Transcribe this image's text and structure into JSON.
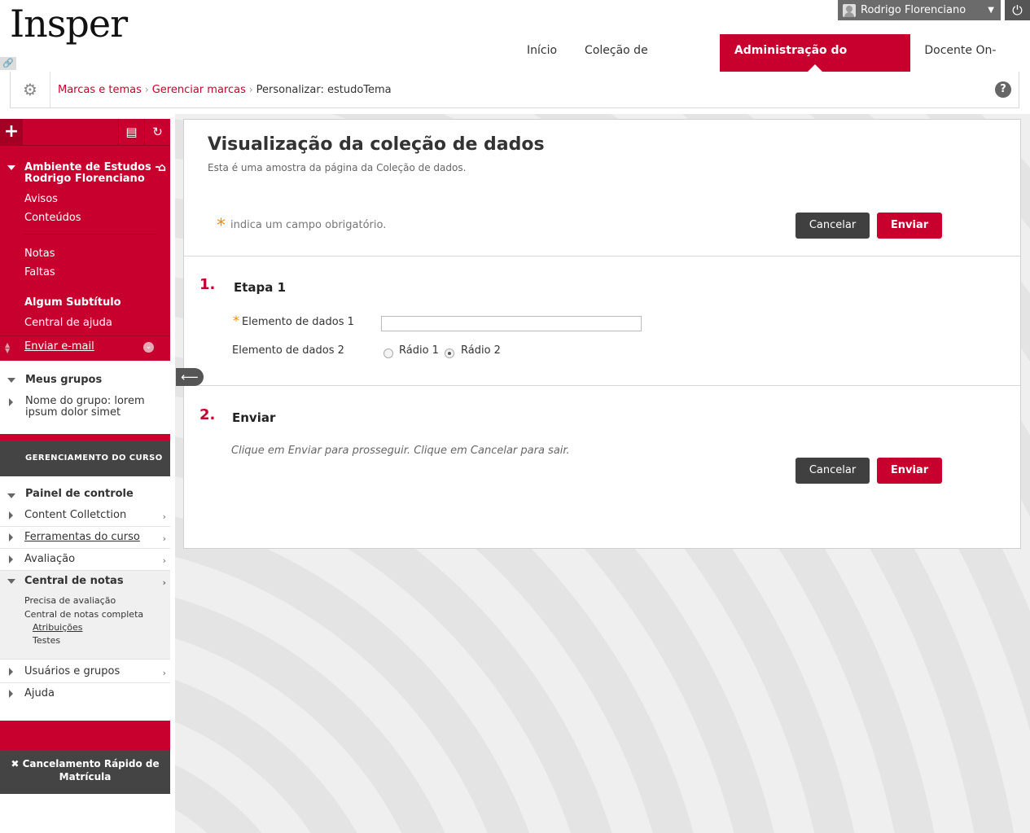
{
  "header": {
    "logo": "Insper",
    "user_name": "Rodrigo Florenciano",
    "nav_tabs": [
      {
        "label": "Início"
      },
      {
        "label": "Coleção de conteúdos"
      },
      {
        "label": "Administração do Sistema",
        "active": true
      },
      {
        "label": "Docente On-Line"
      }
    ]
  },
  "breadcrumb": {
    "items": [
      "Marcas e temas",
      "Gerenciar marcas"
    ],
    "current": "Personalizar: estudoTema",
    "separator": "›",
    "help": "?"
  },
  "sidebar": {
    "course_title": "Ambiente de Estudos - Rodrigo Florenciano",
    "links_1": [
      "Avisos",
      "Conteúdos"
    ],
    "links_2": [
      "Notas",
      "Faltas"
    ],
    "subtitle": "Algum Subtítulo",
    "help_center": "Central de ajuda",
    "email": "Enviar e-mail",
    "groups_title": "Meus grupos",
    "group_name": "Nome do grupo: lorem ipsum dolor simet",
    "management_title": "GERENCIAMENTO DO CURSO",
    "panel_title": "Painel de controle",
    "panel_items": [
      "Content Colletction",
      "Ferramentas do curso",
      "Avaliação",
      "Central de notas"
    ],
    "grade_sub": [
      "Precisa de avaliação",
      "Central de notas completa"
    ],
    "grade_sub2": [
      "Atribuições",
      "Testes"
    ],
    "panel_items_2": [
      "Usuários e grupos",
      "Ajuda"
    ],
    "quick_unenroll": "Cancelamento Rápido de Matrícula"
  },
  "main": {
    "title": "Visualização da coleção de dados",
    "subtitle": "Esta é uma amostra da página da Coleção de dados.",
    "required_note": "indica um campo obrigatório.",
    "cancel_label": "Cancelar",
    "submit_label": "Enviar",
    "step1": {
      "number": "1.",
      "title": "Etapa 1"
    },
    "field1_label": "Elemento de dados 1",
    "field1_value": "",
    "field2_label": "Elemento de dados 2",
    "radio_options": [
      "Rádio 1",
      "Rádio 2"
    ],
    "radio_selected": "Rádio 2",
    "step2": {
      "number": "2.",
      "title": "Enviar"
    },
    "instructions": "Clique em Enviar para prosseguir. Clique em Cancelar para sair."
  },
  "colors": {
    "brand_red": "#c8002d",
    "dark_gray": "#404040",
    "required_orange": "#f08c00"
  }
}
